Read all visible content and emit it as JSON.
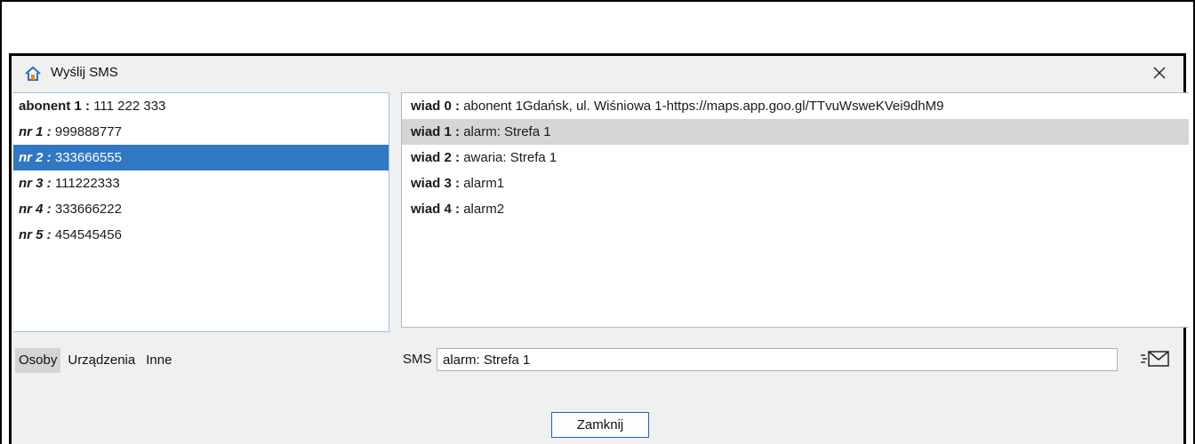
{
  "window": {
    "title": "Wyślij SMS"
  },
  "people": [
    {
      "label": "abonent 1 :",
      "value": "111 222 333",
      "italic": false
    },
    {
      "label": "nr 1 :",
      "value": "999888777",
      "italic": true
    },
    {
      "label": "nr 2 :",
      "value": "333666555",
      "italic": true
    },
    {
      "label": "nr 3 :",
      "value": "111222333",
      "italic": true
    },
    {
      "label": "nr 4 :",
      "value": "333666222",
      "italic": true
    },
    {
      "label": "nr 5 :",
      "value": "454545456",
      "italic": true
    }
  ],
  "messages": [
    {
      "label": "wiad 0 :",
      "value": "abonent 1Gdańsk, ul. Wiśniowa 1-https://maps.app.goo.gl/TTvuWsweKVei9dhM9"
    },
    {
      "label": "wiad 1 :",
      "value": "alarm: Strefa 1"
    },
    {
      "label": "wiad 2 :",
      "value": "awaria: Strefa 1"
    },
    {
      "label": "wiad 3 :",
      "value": "alarm1"
    },
    {
      "label": "wiad 4 :",
      "value": "alarm2"
    }
  ],
  "tabs": [
    "Osoby",
    "Urządzenia",
    "Inne"
  ],
  "sms": {
    "label": "SMS",
    "value": "alarm: Strefa 1"
  },
  "buttons": {
    "close": "Zamknij"
  },
  "colors": {
    "selection_blue": "#3077c4",
    "selection_gray": "#d6d6d6",
    "button_border": "#0a64c8",
    "icon_blue": "#1e6fd0",
    "icon_orange": "#f08a00"
  }
}
